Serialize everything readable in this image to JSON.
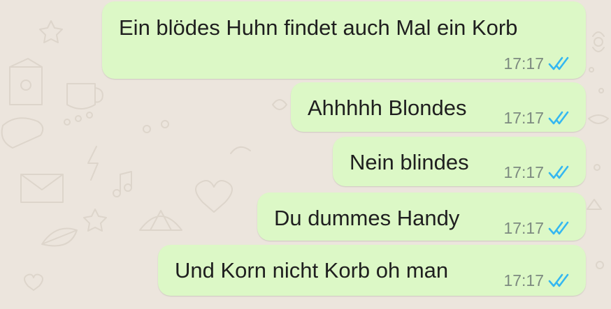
{
  "colors": {
    "wallpaper": "#ece5dd",
    "bubble_outgoing": "#dcf8c6",
    "message_text": "#1f1f1f",
    "timestamp_text": "#7d8a80",
    "read_ticks": "#34b7f1"
  },
  "messages": [
    {
      "text": "Ein blödes Huhn findet auch Mal ein Korb",
      "time": "17:17",
      "status_icon": "double-check-read-icon"
    },
    {
      "text": "Ahhhhh Blondes",
      "time": "17:17",
      "status_icon": "double-check-read-icon"
    },
    {
      "text": "Nein blindes",
      "time": "17:17",
      "status_icon": "double-check-read-icon"
    },
    {
      "text": "Du dummes Handy",
      "time": "17:17",
      "status_icon": "double-check-read-icon"
    },
    {
      "text": "Und Korn nicht Korb oh man",
      "time": "17:17",
      "status_icon": "double-check-read-icon"
    }
  ]
}
